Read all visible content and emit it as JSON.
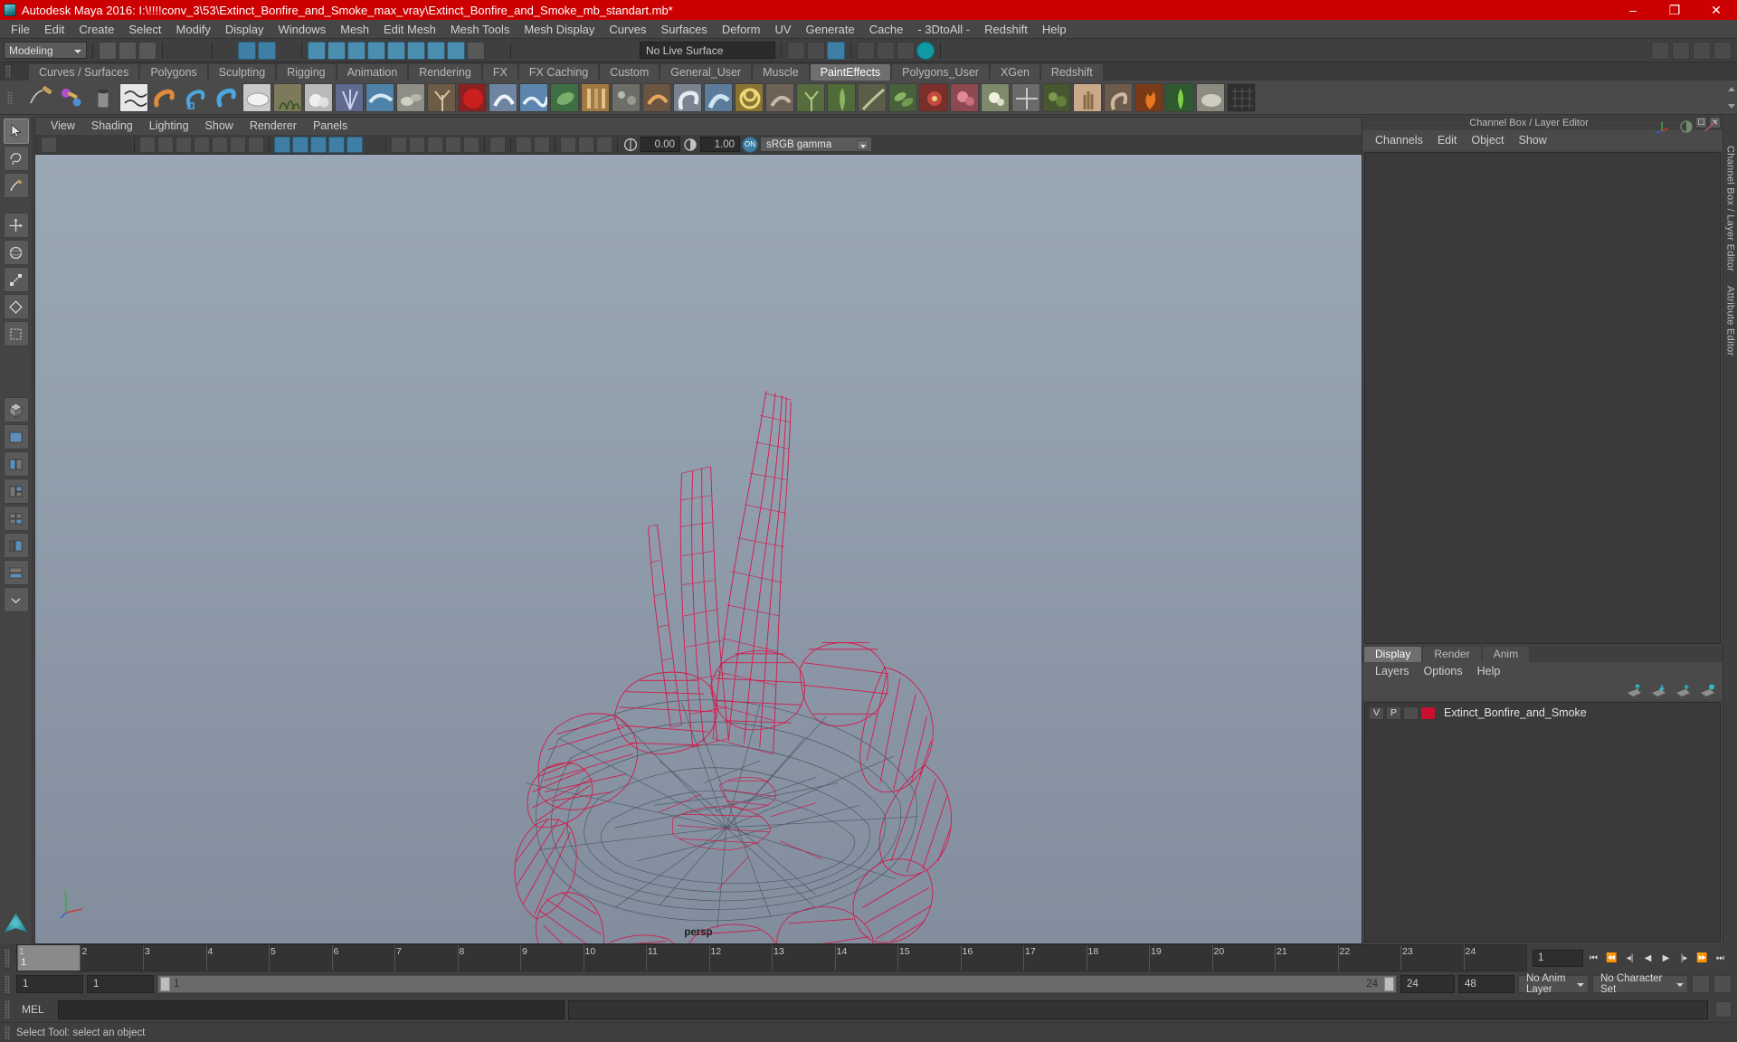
{
  "window": {
    "title": "Autodesk Maya 2016: I:\\!!!!conv_3\\53\\Extinct_Bonfire_and_Smoke_max_vray\\Extinct_Bonfire_and_Smoke_mb_standart.mb*",
    "icon": "maya-app-icon",
    "minimize": "–",
    "maximize": "❐",
    "close": "✕",
    "titlebar_color": "#cc0000"
  },
  "menubar": {
    "items": [
      "File",
      "Edit",
      "Create",
      "Select",
      "Modify",
      "Display",
      "Windows",
      "Mesh",
      "Edit Mesh",
      "Mesh Tools",
      "Mesh Display",
      "Curves",
      "Surfaces",
      "Deform",
      "UV",
      "Generate",
      "Cache",
      "- 3DtoAll -",
      "Redshift",
      "Help"
    ]
  },
  "statusline": {
    "menuset": "Modeling",
    "live_surface": "No Live Surface"
  },
  "shelf": {
    "tabs": [
      "Curves / Surfaces",
      "Polygons",
      "Sculpting",
      "Rigging",
      "Animation",
      "Rendering",
      "FX",
      "FX Caching",
      "Custom",
      "General_User",
      "Muscle",
      "PaintEffects",
      "Polygons_User",
      "XGen",
      "Redshift"
    ],
    "active_tab": "PaintEffects"
  },
  "panel": {
    "menus": [
      "View",
      "Shading",
      "Lighting",
      "Show",
      "Renderer",
      "Panels"
    ],
    "camera_label": "persp",
    "gamma": {
      "exposure_value": "0.00",
      "gamma_value": "1.00",
      "toggle_label": "ON",
      "view_transform": "sRGB gamma"
    }
  },
  "channelbox": {
    "dock_title": "Channel Box / Layer Editor",
    "menus": [
      "Channels",
      "Edit",
      "Object",
      "Show"
    ],
    "vertical_tabs": [
      "Channel Box / Layer Editor",
      "Attribute Editor"
    ]
  },
  "layereditor": {
    "tabs": [
      "Display",
      "Render",
      "Anim"
    ],
    "active_tab": "Display",
    "menus": [
      "Layers",
      "Options",
      "Help"
    ],
    "columns": [
      "V",
      "P"
    ],
    "layers": [
      {
        "visible": "V",
        "playback": "P",
        "type": "",
        "color": "#c8102e",
        "name": "Extinct_Bonfire_and_Smoke"
      }
    ]
  },
  "timeline": {
    "ticks": [
      "1",
      "2",
      "3",
      "4",
      "5",
      "6",
      "7",
      "8",
      "9",
      "10",
      "11",
      "12",
      "13",
      "14",
      "15",
      "16",
      "17",
      "18",
      "19",
      "20",
      "21",
      "22",
      "23",
      "24"
    ],
    "current_frame": "1",
    "frame_field": "1",
    "playback_icons": [
      "⏮",
      "⏴⏴",
      "⏴",
      "◀",
      "▶",
      "⏵",
      "⏵⏵",
      "⏭"
    ]
  },
  "rangeslider": {
    "start": "1",
    "anim_start": "1",
    "range_start": "1",
    "range_end": "24",
    "anim_end": "24",
    "playback_end": "48",
    "anim_layer": "No Anim Layer",
    "character_set": "No Character Set"
  },
  "commandline": {
    "language": "MEL",
    "input_value": "",
    "output_value": ""
  },
  "statusbar": {
    "help_text": "Select Tool: select an object"
  },
  "scene": {
    "object_color": "#d6174a",
    "background_top": "#9aa7b4",
    "background_bottom": "#828e9d",
    "description": "Extinct bonfire and smoke wireframe model"
  }
}
